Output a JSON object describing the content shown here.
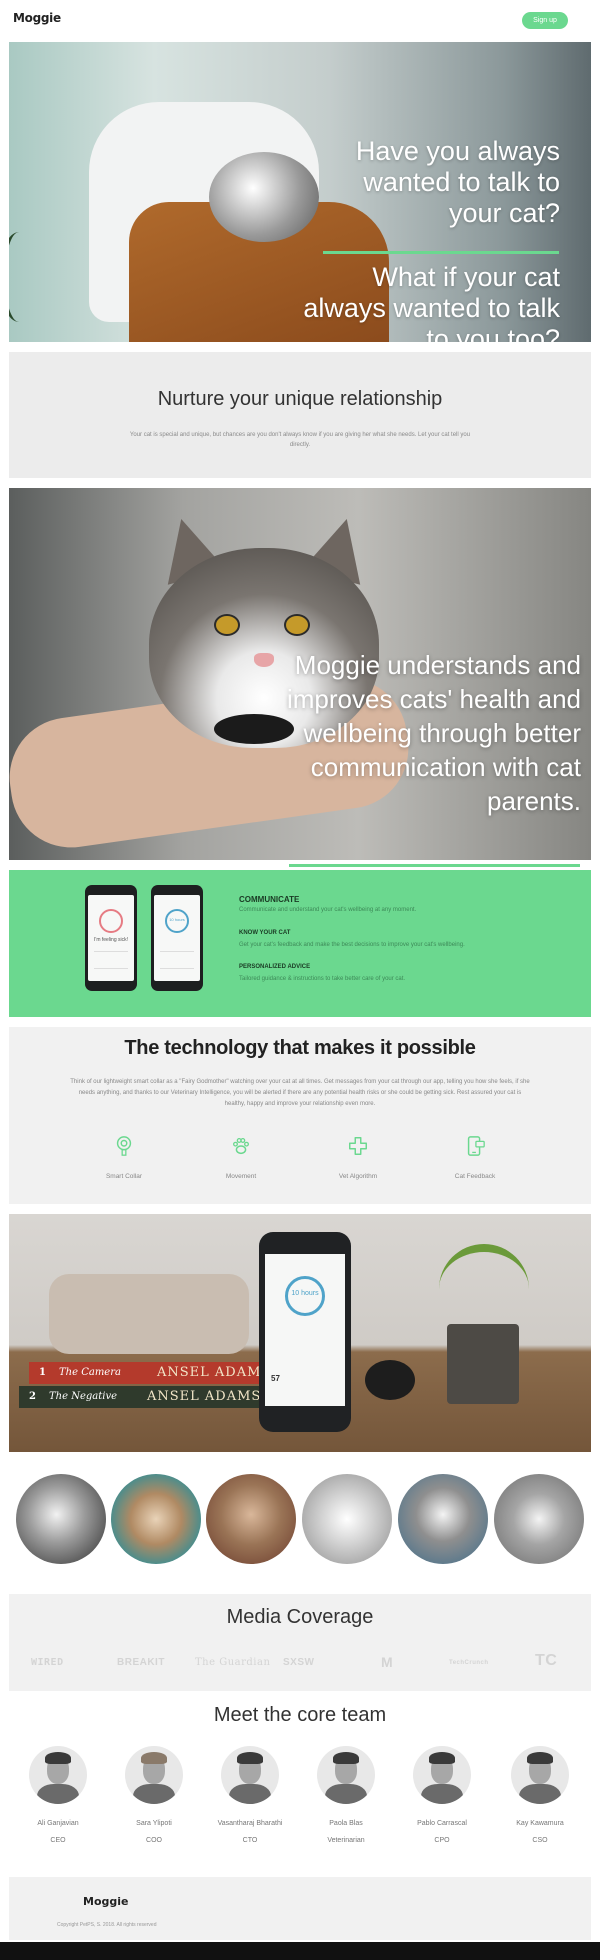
{
  "header": {
    "logo": "Moggie",
    "signup_label": "Sign up"
  },
  "hero": {
    "headline": "Have you always wanted to talk to your cat?",
    "subheadline": "What if your cat always wanted to talk to you too?"
  },
  "nurture": {
    "title": "Nurture your unique relationship",
    "body": "Your cat is special and unique, but chances are you don't always know if you are giving her what she needs. Let your cat tell you directly."
  },
  "cat_photo": {
    "caption": "Moggie understands and improves cats' health and wellbeing through better communication with cat parents."
  },
  "features": {
    "phone1_text": "I'm feeling sick!",
    "phone2_text": "10 hours",
    "items": [
      {
        "title": "COMMUNICATE",
        "desc": "Communicate and understand your cat's wellbeing at any moment."
      },
      {
        "title": "KNOW YOUR CAT",
        "desc": "Get your cat's feedback and make the best decisions to improve your cat's wellbeing."
      },
      {
        "title": "PERSONALIZED ADVICE",
        "desc": "Tailored guidance & instructions to take better care of your cat."
      }
    ]
  },
  "technology": {
    "title": "The technology that makes it possible",
    "body": "Think of our lightweight smart collar as a \"Fairy Godmother\" watching over your cat at all times. Get messages from your cat through our app, telling you how she feels, if she needs anything, and thanks to our Veterinary Intelligence, you will be alerted if there are any potential health risks or she could be getting sick. Rest assured your cat is healthy, happy and improve your relationship even more.",
    "items": [
      {
        "label": "Smart Collar",
        "icon": "collar-icon"
      },
      {
        "label": "Movement",
        "icon": "paw-icon"
      },
      {
        "label": "Vet Algorithm",
        "icon": "medical-cross-icon"
      },
      {
        "label": "Cat Feedback",
        "icon": "phone-feedback-icon"
      }
    ]
  },
  "product_photo": {
    "book1_num": "1",
    "book1_title": "The Camera",
    "book1_author": "ANSEL ADAMS",
    "book2_num": "2",
    "book2_title": "The Negative",
    "book2_author": "ANSEL ADAMS",
    "phone_time": "10 hours",
    "phone_stat": "57"
  },
  "media": {
    "title": "Media Coverage",
    "logos": [
      "WIRED",
      "BREAKIT",
      "The Guardian",
      "SXSW",
      "M",
      "TechCrunch",
      "TC"
    ]
  },
  "team": {
    "title": "Meet the core team",
    "members": [
      {
        "name": "Ali Ganjavian",
        "role": "CEO"
      },
      {
        "name": "Sara Ylipoti",
        "role": "COO"
      },
      {
        "name": "Vasantharaj Bharathi",
        "role": "CTO"
      },
      {
        "name": "Paola Blas",
        "role": "Veterinarian"
      },
      {
        "name": "Pablo Carrascal",
        "role": "CPO"
      },
      {
        "name": "Kay Kawamura",
        "role": "CSO"
      }
    ]
  },
  "footer": {
    "logo": "Moggie",
    "copyright": "Copyright PetPS, S. 2018. All rights reserved"
  },
  "colors": {
    "accent": "#6bd88f",
    "section_grey": "#ececec",
    "text_dark": "#333333"
  }
}
